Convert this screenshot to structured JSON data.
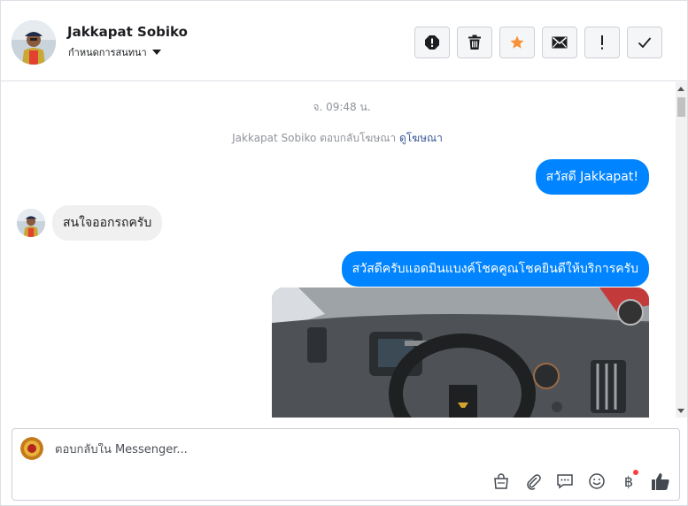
{
  "header": {
    "name": "Jakkapat Sobiko",
    "subtitle": "กำหนดการสนทนา",
    "tools": [
      {
        "name": "report-spam-button",
        "icon": "alert-circle-icon"
      },
      {
        "name": "delete-button",
        "icon": "trash-icon"
      },
      {
        "name": "star-button",
        "icon": "star-icon"
      },
      {
        "name": "mark-unread-button",
        "icon": "envelope-icon"
      },
      {
        "name": "flag-button",
        "icon": "exclamation-icon"
      },
      {
        "name": "mark-done-button",
        "icon": "checkmark-icon"
      }
    ],
    "star_color": "#f7923b"
  },
  "thread": {
    "timestamp": "จ. 09:48 น.",
    "notice_prefix": "Jakkapat Sobiko ตอบกลับโฆษณา",
    "notice_link": "ดูโฆษณา",
    "messages": [
      {
        "direction": "out",
        "text": "สวัสดี Jakkapat!"
      },
      {
        "direction": "in",
        "text": "สนใจออกรถครับ"
      },
      {
        "direction": "out",
        "text": "สวัสดีครับแอดมินแบงค์โชคคูณโชคยินดีให้บริการครับ"
      }
    ],
    "accent_color": "#0084ff"
  },
  "composer": {
    "placeholder": "ตอบกลับใน Messenger...",
    "icons": [
      "shopping-bag-icon",
      "paperclip-icon",
      "saved-reply-icon",
      "emoji-icon",
      "baht-payment-icon",
      "thumbs-up-icon"
    ],
    "baht_symbol": "฿"
  }
}
